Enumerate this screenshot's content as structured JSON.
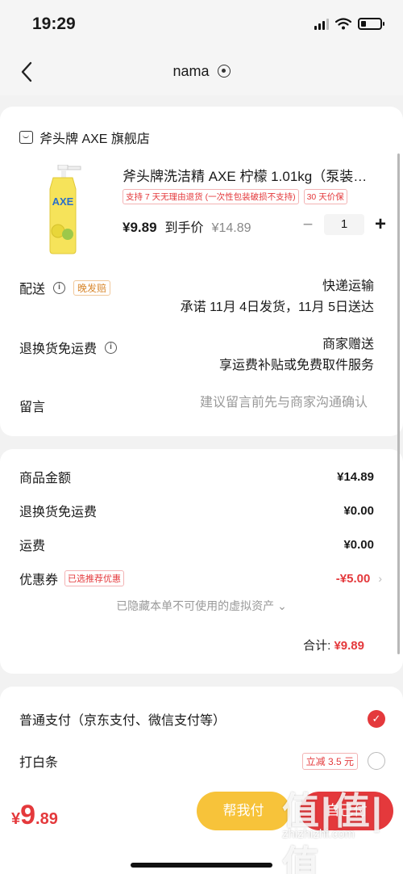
{
  "status_bar": {
    "time": "19:29"
  },
  "nav": {
    "title": "nama"
  },
  "shop": {
    "name": "斧头牌 AXE 旗舰店"
  },
  "product": {
    "title": "斧头牌洗洁精 AXE 柠檬 1.01kg（泵装…",
    "tags": [
      "支持 7 天无理由退货 (一次性包装破损不支持)",
      "30 天价保"
    ],
    "price": "¥9.89",
    "price_suffix": "到手价",
    "original_price": "¥14.89",
    "quantity": "1",
    "image_brand": "AXE"
  },
  "delivery": {
    "label": "配送",
    "badge": "晚发赔",
    "method": "快递运输",
    "promise": "承诺 11月 4日发货，11月 5日送达"
  },
  "return_shipping": {
    "label": "退换货免运费",
    "line1": "商家赠送",
    "line2": "享运费补贴或免费取件服务"
  },
  "message": {
    "label": "留言",
    "placeholder": "建议留言前先与商家沟通确认"
  },
  "summary": {
    "goods_label": "商品金额",
    "goods_value": "¥14.89",
    "return_label": "退换货免运费",
    "return_value": "¥0.00",
    "freight_label": "运费",
    "freight_value": "¥0.00",
    "coupon_label": "优惠券",
    "coupon_tag": "已选推荐优惠",
    "coupon_value": "-¥5.00",
    "hidden_note": "已隐藏本单不可使用的虚拟资产",
    "total_label": "合计:",
    "total_value": "¥9.89"
  },
  "payment": {
    "option1": "普通支付（京东支付、微信支付等）",
    "option2": "打白条",
    "option2_tag": "立减 3.5 元"
  },
  "bottom": {
    "currency": "¥",
    "price_int": "9",
    "price_dec": ".89",
    "help_pay": "帮我付",
    "self_pay": "自己付",
    "watermark": "值|值|值",
    "watermark_url": "zhizhizhi.com"
  },
  "colors": {
    "accent": "#e4393c",
    "yellow": "#f7c33a"
  }
}
